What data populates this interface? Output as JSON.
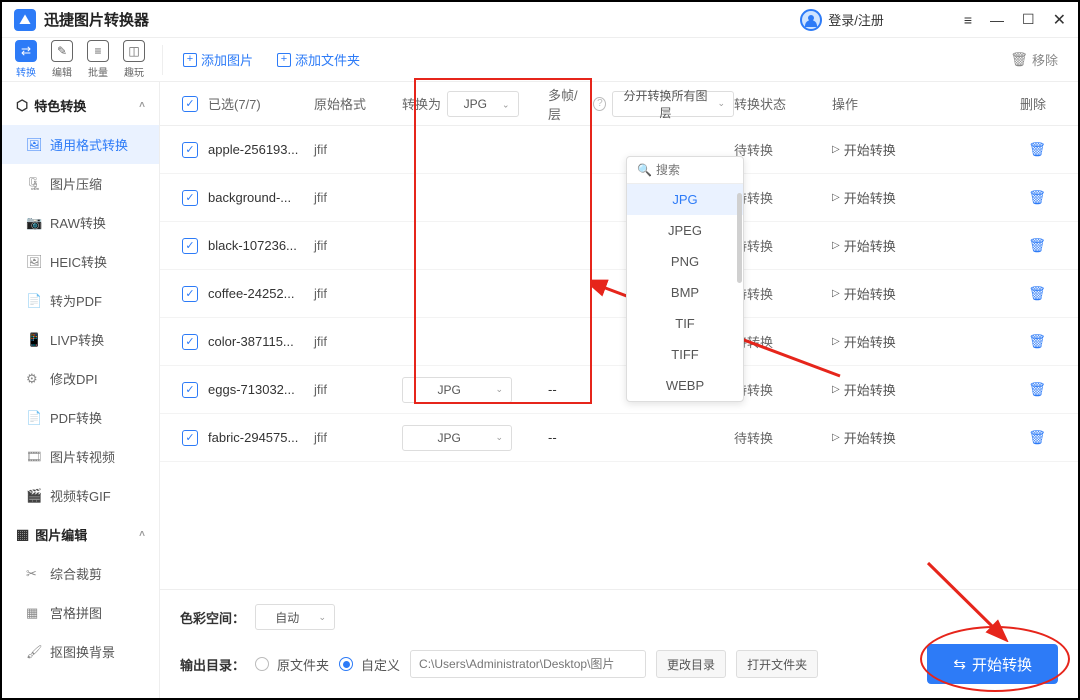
{
  "app": {
    "title": "迅捷图片转换器"
  },
  "titlebar": {
    "login": "登录/注册"
  },
  "modes": [
    {
      "label": "转换",
      "icon": "⇄"
    },
    {
      "label": "编辑",
      "icon": "✎"
    },
    {
      "label": "批量",
      "icon": "≡"
    },
    {
      "label": "趣玩",
      "icon": "◫"
    }
  ],
  "toolbar": {
    "add_image": "添加图片",
    "add_folder": "添加文件夹",
    "remove": "移除"
  },
  "sidebar": {
    "group1": "特色转换",
    "items1": [
      {
        "label": "通用格式转换",
        "icon": "🖼"
      },
      {
        "label": "图片压缩",
        "icon": "🗜"
      },
      {
        "label": "RAW转换",
        "icon": "📷"
      },
      {
        "label": "HEIC转换",
        "icon": "🖼"
      },
      {
        "label": "转为PDF",
        "icon": "📄"
      },
      {
        "label": "LIVP转换",
        "icon": "📱"
      },
      {
        "label": "修改DPI",
        "icon": "⚙"
      },
      {
        "label": "PDF转换",
        "icon": "📄"
      },
      {
        "label": "图片转视频",
        "icon": "🎞"
      },
      {
        "label": "视频转GIF",
        "icon": "🎬"
      }
    ],
    "group2": "图片编辑",
    "items2": [
      {
        "label": "综合裁剪",
        "icon": "✂"
      },
      {
        "label": "宫格拼图",
        "icon": "▦"
      },
      {
        "label": "抠图换背景",
        "icon": "🖌"
      }
    ]
  },
  "table": {
    "headers": {
      "selected": "已选(7/7)",
      "orig_fmt": "原始格式",
      "convert_to": "转换为",
      "multi_frame": "多帧/层",
      "status": "转换状态",
      "op": "操作",
      "del": "删除"
    },
    "header_format_dropdown": "JPG",
    "header_layer_dropdown": "分开转换所有图层",
    "rows": [
      {
        "name": "apple-256193...",
        "fmt": "jfif",
        "conv": "",
        "multi": "",
        "status": "待转换"
      },
      {
        "name": "background-...",
        "fmt": "jfif",
        "conv": "",
        "multi": "",
        "status": "待转换"
      },
      {
        "name": "black-107236...",
        "fmt": "jfif",
        "conv": "",
        "multi": "",
        "status": "待转换"
      },
      {
        "name": "coffee-24252...",
        "fmt": "jfif",
        "conv": "",
        "multi": "",
        "status": "待转换"
      },
      {
        "name": "color-387115...",
        "fmt": "jfif",
        "conv": "",
        "multi": "",
        "status": "待转换"
      },
      {
        "name": "eggs-713032...",
        "fmt": "jfif",
        "conv": "JPG",
        "multi": "--",
        "status": "待转换"
      },
      {
        "name": "fabric-294575...",
        "fmt": "jfif",
        "conv": "JPG",
        "multi": "--",
        "status": "待转换"
      }
    ],
    "start_label": "开始转换"
  },
  "format_popup": {
    "search_placeholder": "搜索",
    "options": [
      "JPG",
      "JPEG",
      "PNG",
      "BMP",
      "TIF",
      "TIFF",
      "WEBP"
    ],
    "selected": "JPG"
  },
  "footer": {
    "colorspace_label": "色彩空间：",
    "colorspace_value": "自动",
    "output_label": "输出目录：",
    "radio_orig": "原文件夹",
    "radio_custom": "自定义",
    "path_placeholder": "C:\\Users\\Administrator\\Desktop\\图片",
    "change_dir": "更改目录",
    "open_folder": "打开文件夹",
    "start": "开始转换"
  }
}
